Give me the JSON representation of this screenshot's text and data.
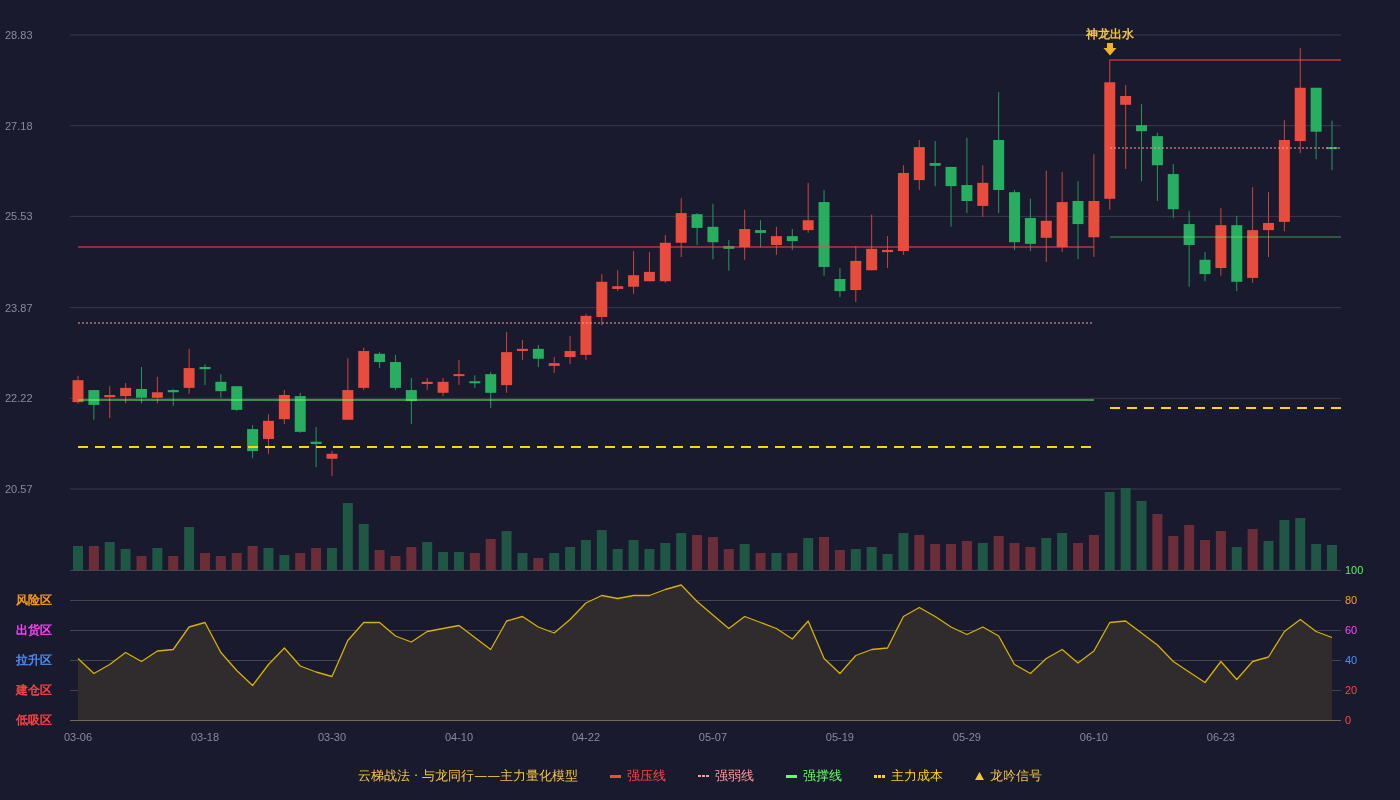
{
  "price_panel": {
    "chart_data": {
      "type": "candlestick",
      "grid": true,
      "ylim": [
        20.57,
        28.83
      ],
      "yticks": [
        28.83,
        27.18,
        25.53,
        23.87,
        22.22,
        20.57
      ],
      "ohlc": [
        [
          22.15,
          22.63,
          22.12,
          22.55
        ],
        [
          22.37,
          22.37,
          21.83,
          22.1
        ],
        [
          22.24,
          22.44,
          21.86,
          22.28
        ],
        [
          22.26,
          22.5,
          22.13,
          22.41
        ],
        [
          22.39,
          22.79,
          22.13,
          22.23
        ],
        [
          22.23,
          22.61,
          22.13,
          22.33
        ],
        [
          22.37,
          22.39,
          22.08,
          22.33
        ],
        [
          22.41,
          23.12,
          22.3,
          22.77
        ],
        [
          22.79,
          22.84,
          22.46,
          22.75
        ],
        [
          22.52,
          22.66,
          22.23,
          22.35
        ],
        [
          22.44,
          22.44,
          21.99,
          22.01
        ],
        [
          21.66,
          21.73,
          21.13,
          21.26
        ],
        [
          21.48,
          21.93,
          21.21,
          21.81
        ],
        [
          21.84,
          22.37,
          21.75,
          22.28
        ],
        [
          22.26,
          22.32,
          21.59,
          21.61
        ],
        [
          21.43,
          21.7,
          20.97,
          21.39
        ],
        [
          21.12,
          21.26,
          20.81,
          21.21
        ],
        [
          21.83,
          22.95,
          21.83,
          22.37
        ],
        [
          22.41,
          23.14,
          22.37,
          23.08
        ],
        [
          23.03,
          23.06,
          22.77,
          22.88
        ],
        [
          22.88,
          23.01,
          22.37,
          22.41
        ],
        [
          22.37,
          22.59,
          21.75,
          22.17
        ],
        [
          22.48,
          22.59,
          22.37,
          22.52
        ],
        [
          22.32,
          22.59,
          22.26,
          22.52
        ],
        [
          22.63,
          22.92,
          22.46,
          22.66
        ],
        [
          22.53,
          22.64,
          22.41,
          22.5
        ],
        [
          22.66,
          22.7,
          22.04,
          22.32
        ],
        [
          22.46,
          23.43,
          22.32,
          23.06
        ],
        [
          23.08,
          23.28,
          22.92,
          23.12
        ],
        [
          23.12,
          23.19,
          22.79,
          22.94
        ],
        [
          22.81,
          22.97,
          22.68,
          22.86
        ],
        [
          22.97,
          23.35,
          22.84,
          23.08
        ],
        [
          23.01,
          23.75,
          22.92,
          23.72
        ],
        [
          23.7,
          24.48,
          23.55,
          24.34
        ],
        [
          24.21,
          24.55,
          24.17,
          24.26
        ],
        [
          24.25,
          24.9,
          24.12,
          24.46
        ],
        [
          24.35,
          24.88,
          24.35,
          24.52
        ],
        [
          24.35,
          25.19,
          24.32,
          25.05
        ],
        [
          25.05,
          25.86,
          24.79,
          25.59
        ],
        [
          25.57,
          25.59,
          25.01,
          25.32
        ],
        [
          25.34,
          25.76,
          24.75,
          25.06
        ],
        [
          24.99,
          25.1,
          24.54,
          24.94
        ],
        [
          24.97,
          25.65,
          24.74,
          25.3
        ],
        [
          25.28,
          25.46,
          24.97,
          25.23
        ],
        [
          25.01,
          25.34,
          24.83,
          25.17
        ],
        [
          25.17,
          25.3,
          24.92,
          25.08
        ],
        [
          25.28,
          26.14,
          25.23,
          25.46
        ],
        [
          25.79,
          26.01,
          24.45,
          24.61
        ],
        [
          24.39,
          24.59,
          24.06,
          24.17
        ],
        [
          24.19,
          24.99,
          23.97,
          24.72
        ],
        [
          24.55,
          25.56,
          24.55,
          24.94
        ],
        [
          24.88,
          25.17,
          24.59,
          24.92
        ],
        [
          24.9,
          26.46,
          24.83,
          26.32
        ],
        [
          26.19,
          26.92,
          26.01,
          26.79
        ],
        [
          26.5,
          26.9,
          26.08,
          26.45
        ],
        [
          26.43,
          26.43,
          25.34,
          26.08
        ],
        [
          26.1,
          26.96,
          25.59,
          25.81
        ],
        [
          25.72,
          26.46,
          25.52,
          26.14
        ],
        [
          26.92,
          27.79,
          25.59,
          26.01
        ],
        [
          25.97,
          26.01,
          24.92,
          25.06
        ],
        [
          25.5,
          25.85,
          24.9,
          25.03
        ],
        [
          25.14,
          26.36,
          24.7,
          25.45
        ],
        [
          24.97,
          26.34,
          24.88,
          25.79
        ],
        [
          25.81,
          26.17,
          24.75,
          25.39
        ],
        [
          25.15,
          26.66,
          24.79,
          25.81
        ],
        [
          25.85,
          28.38,
          25.65,
          27.97
        ],
        [
          27.56,
          27.92,
          26.39,
          27.72
        ],
        [
          27.19,
          27.57,
          26.17,
          27.08
        ],
        [
          26.99,
          27.05,
          25.81,
          26.46
        ],
        [
          26.3,
          26.48,
          25.5,
          25.66
        ],
        [
          25.39,
          25.63,
          24.25,
          25.01
        ],
        [
          24.74,
          24.88,
          24.35,
          24.48
        ],
        [
          24.59,
          25.68,
          24.45,
          25.37
        ],
        [
          25.37,
          25.54,
          24.17,
          24.34
        ],
        [
          24.41,
          26.06,
          24.32,
          25.28
        ],
        [
          25.28,
          25.97,
          24.79,
          25.41
        ],
        [
          25.43,
          27.28,
          25.26,
          26.92
        ],
        [
          26.9,
          28.59,
          26.68,
          27.87
        ],
        [
          27.87,
          27.87,
          26.57,
          27.07
        ],
        [
          26.79,
          27.27,
          26.37,
          26.76
        ]
      ]
    },
    "signal": {
      "label": "神龙出水"
    }
  },
  "indicator_panel": {
    "zones": [
      {
        "label": "风险区",
        "color": "#ff9f1a"
      },
      {
        "label": "出货区",
        "color": "#ff44ff"
      },
      {
        "label": "拉升区",
        "color": "#4f8ff7"
      },
      {
        "label": "建仓区",
        "color": "#ff4444"
      },
      {
        "label": "低吸区",
        "color": "#ff4444"
      }
    ],
    "chart_data": {
      "type": "area",
      "grid": true,
      "ylim": [
        0,
        100
      ],
      "yticks": [
        0,
        20,
        40,
        60,
        80,
        100
      ],
      "categories": [
        "03-06",
        null,
        null,
        null,
        null,
        null,
        null,
        null,
        "03-18",
        null,
        null,
        null,
        null,
        null,
        null,
        null,
        "03-30",
        null,
        null,
        null,
        null,
        null,
        null,
        null,
        "04-10",
        null,
        null,
        null,
        null,
        null,
        null,
        null,
        "04-22",
        null,
        null,
        null,
        null,
        null,
        null,
        null,
        "05-07",
        null,
        null,
        null,
        null,
        null,
        null,
        null,
        "05-19",
        null,
        null,
        null,
        null,
        null,
        null,
        null,
        "05-29",
        null,
        null,
        null,
        null,
        null,
        null,
        null,
        "06-10",
        null,
        null,
        null,
        null,
        null,
        null,
        null,
        "06-23",
        null,
        null,
        null,
        null,
        null,
        null,
        null
      ],
      "values": [
        41,
        31,
        37,
        45,
        39,
        46,
        47,
        62,
        65,
        45,
        33,
        23,
        37,
        48,
        36,
        32,
        29,
        53,
        65,
        65,
        56,
        52,
        59,
        61,
        63,
        55,
        47,
        66,
        69,
        62,
        58,
        67,
        78,
        83,
        81,
        83,
        83,
        87,
        90,
        79,
        70,
        61,
        69,
        65,
        61,
        54,
        66,
        41,
        31,
        43,
        47,
        48,
        69,
        75,
        69,
        62,
        57,
        62,
        56,
        37,
        31,
        41,
        47,
        38,
        46,
        65,
        66,
        58,
        50,
        39,
        32,
        25,
        39,
        27,
        39,
        42,
        59,
        67,
        59,
        55
      ]
    }
  },
  "legend": {
    "title": "云梯战法 · 与龙同行——主力量化模型",
    "items": [
      {
        "label": "强压线",
        "kind": "solid",
        "color": "#ff4444"
      },
      {
        "label": "强弱线",
        "kind": "dotted",
        "color": "#ff9a9a"
      },
      {
        "label": "强撑线",
        "kind": "solid",
        "color": "#66ff66"
      },
      {
        "label": "主力成本",
        "kind": "dashed",
        "color": "#ffd700"
      },
      {
        "label": "龙吟信号",
        "kind": "triangle",
        "color": "#f5c542"
      }
    ]
  }
}
